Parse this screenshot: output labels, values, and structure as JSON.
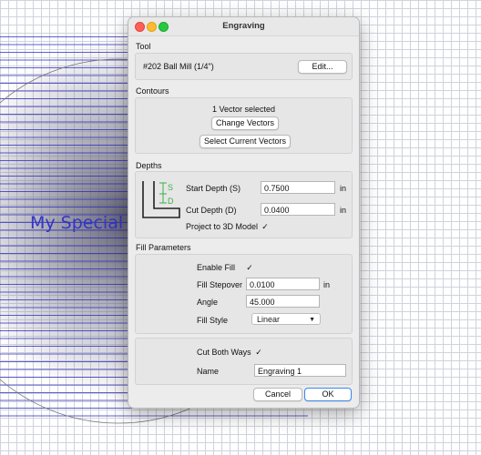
{
  "canvas": {
    "text": "My Special T"
  },
  "dialog": {
    "title": "Engraving",
    "tool": {
      "section": "Tool",
      "name": "#202 Ball Mill (1/4\")",
      "edit_button": "Edit..."
    },
    "contours": {
      "section": "Contours",
      "status": "1 Vector selected",
      "change_button": "Change Vectors",
      "select_current_button": "Select Current Vectors"
    },
    "depths": {
      "section": "Depths",
      "diagram_s": "S",
      "diagram_d": "D",
      "start_label": "Start Depth (S)",
      "start_value": "0.7500",
      "start_unit": "in",
      "cut_label": "Cut Depth (D)",
      "cut_value": "0.0400",
      "cut_unit": "in",
      "project_label": "Project to 3D Model",
      "project_checked": "✓"
    },
    "fill": {
      "section": "Fill Parameters",
      "enable_label": "Enable Fill",
      "enable_checked": "✓",
      "stepover_label": "Fill Stepover",
      "stepover_value": "0.0100",
      "stepover_unit": "in",
      "angle_label": "Angle",
      "angle_value": "45.000",
      "style_label": "Fill Style",
      "style_value": "Linear"
    },
    "naming": {
      "cut_both_label": "Cut Both Ways",
      "cut_both_checked": "✓",
      "name_label": "Name",
      "name_value": "Engraving 1"
    },
    "cancel_button": "Cancel",
    "ok_button": "OK"
  },
  "colors": {
    "accent": "#3d86f0",
    "canvas_text": "#3434c8",
    "depth_diagram": "#3cb043"
  }
}
